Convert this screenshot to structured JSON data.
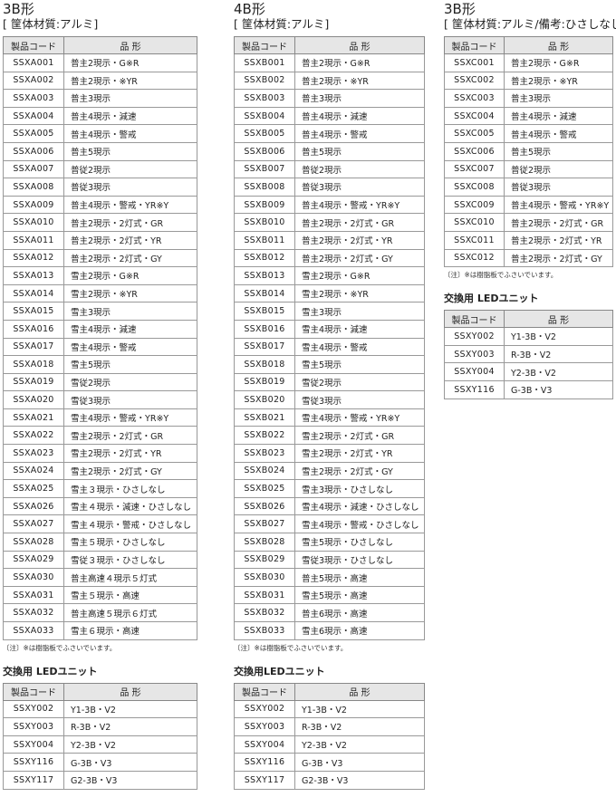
{
  "headers": {
    "code": "製品コード",
    "name": "品 形"
  },
  "sections": [
    {
      "title": "3B形",
      "subtitle": "[ 筐体材質:アルミ]",
      "rows": [
        [
          "SSXA001",
          "普主2現示・G※R"
        ],
        [
          "SSXA002",
          "普主2現示・※YR"
        ],
        [
          "SSXA003",
          "普主3現示"
        ],
        [
          "SSXA004",
          "普主4現示・減速"
        ],
        [
          "SSXA005",
          "普主4現示・警戒"
        ],
        [
          "SSXA006",
          "普主5現示"
        ],
        [
          "SSXA007",
          "普従2現示"
        ],
        [
          "SSXA008",
          "普従3現示"
        ],
        [
          "SSXA009",
          "普主4現示・警戒・YR※Y"
        ],
        [
          "SSXA010",
          "普主2現示・2灯式・GR"
        ],
        [
          "SSXA011",
          "普主2現示・2灯式・YR"
        ],
        [
          "SSXA012",
          "普主2現示・2灯式・GY"
        ],
        [
          "SSXA013",
          "雪主2現示・G※R"
        ],
        [
          "SSXA014",
          "雪主2現示・※YR"
        ],
        [
          "SSXA015",
          "雪主3現示"
        ],
        [
          "SSXA016",
          "雪主4現示・減速"
        ],
        [
          "SSXA017",
          "雪主4現示・警戒"
        ],
        [
          "SSXA018",
          "雪主5現示"
        ],
        [
          "SSXA019",
          "雪従2現示"
        ],
        [
          "SSXA020",
          "雪従3現示"
        ],
        [
          "SSXA021",
          "雪主4現示・警戒・YR※Y"
        ],
        [
          "SSXA022",
          "雪主2現示・2灯式・GR"
        ],
        [
          "SSXA023",
          "雪主2現示・2灯式・YR"
        ],
        [
          "SSXA024",
          "雪主2現示・2灯式・GY"
        ],
        [
          "SSXA025",
          "雪主３現示・ひさしなし"
        ],
        [
          "SSXA026",
          "雪主４現示・減速・ひさしなし"
        ],
        [
          "SSXA027",
          "雪主４現示・警戒・ひさしなし"
        ],
        [
          "SSXA028",
          "雪主５現示・ひさしなし"
        ],
        [
          "SSXA029",
          "雪従３現示・ひさしなし"
        ],
        [
          "SSXA030",
          "普主高速４現示５灯式"
        ],
        [
          "SSXA031",
          "雪主５現示・高速"
        ],
        [
          "SSXA032",
          "普主高速５現示６灯式"
        ],
        [
          "SSXA033",
          "雪主６現示・高速"
        ]
      ],
      "note": "〔注〕※は樹脂板でふさいでいます。",
      "led_title": "交換用 LEDユニット",
      "led_rows": [
        [
          "SSXY002",
          "Y1-3B・V2"
        ],
        [
          "SSXY003",
          "R-3B・V2"
        ],
        [
          "SSXY004",
          "Y2-3B・V2"
        ],
        [
          "SSXY116",
          "G-3B・V3"
        ],
        [
          "SSXY117",
          "G2-3B・V3"
        ]
      ]
    },
    {
      "title": "4B形",
      "subtitle": "[ 筐体材質:アルミ]",
      "rows": [
        [
          "SSXB001",
          "普主2現示・G※R"
        ],
        [
          "SSXB002",
          "普主2現示・※YR"
        ],
        [
          "SSXB003",
          "普主3現示"
        ],
        [
          "SSXB004",
          "普主4現示・減速"
        ],
        [
          "SSXB005",
          "普主4現示・警戒"
        ],
        [
          "SSXB006",
          "普主5現示"
        ],
        [
          "SSXB007",
          "普従2現示"
        ],
        [
          "SSXB008",
          "普従3現示"
        ],
        [
          "SSXB009",
          "普主4現示・警戒・YR※Y"
        ],
        [
          "SSXB010",
          "普主2現示・2灯式・GR"
        ],
        [
          "SSXB011",
          "普主2現示・2灯式・YR"
        ],
        [
          "SSXB012",
          "普主2現示・2灯式・GY"
        ],
        [
          "SSXB013",
          "雪主2現示・G※R"
        ],
        [
          "SSXB014",
          "雪主2現示・※YR"
        ],
        [
          "SSXB015",
          "雪主3現示"
        ],
        [
          "SSXB016",
          "雪主4現示・減速"
        ],
        [
          "SSXB017",
          "雪主4現示・警戒"
        ],
        [
          "SSXB018",
          "雪主5現示"
        ],
        [
          "SSXB019",
          "雪従2現示"
        ],
        [
          "SSXB020",
          "雪従3現示"
        ],
        [
          "SSXB021",
          "雪主4現示・警戒・YR※Y"
        ],
        [
          "SSXB022",
          "雪主2現示・2灯式・GR"
        ],
        [
          "SSXB023",
          "雪主2現示・2灯式・YR"
        ],
        [
          "SSXB024",
          "雪主2現示・2灯式・GY"
        ],
        [
          "SSXB025",
          "雪主3現示・ひさしなし"
        ],
        [
          "SSXB026",
          "雪主4現示・減速・ひさしなし"
        ],
        [
          "SSXB027",
          "雪主4現示・警戒・ひさしなし"
        ],
        [
          "SSXB028",
          "雪主5現示・ひさしなし"
        ],
        [
          "SSXB029",
          "雪従3現示・ひさしなし"
        ],
        [
          "SSXB030",
          "普主5現示・高速"
        ],
        [
          "SSXB031",
          "雪主5現示・高速"
        ],
        [
          "SSXB032",
          "普主6現示・高速"
        ],
        [
          "SSXB033",
          "雪主6現示・高速"
        ]
      ],
      "note": "〔注〕※は樹脂板でふさいでいます。",
      "led_title": "交換用LEDユニット",
      "led_rows": [
        [
          "SSXY002",
          "Y1-3B・V2"
        ],
        [
          "SSXY003",
          "R-3B・V2"
        ],
        [
          "SSXY004",
          "Y2-3B・V2"
        ],
        [
          "SSXY116",
          "G-3B・V3"
        ],
        [
          "SSXY117",
          "G2-3B・V3"
        ]
      ]
    },
    {
      "title": "3B形",
      "subtitle": "[ 筐体材質:アルミ/備考:ひさしなし]",
      "rows": [
        [
          "SSXC001",
          "普主2現示・G※R"
        ],
        [
          "SSXC002",
          "普主2現示・※YR"
        ],
        [
          "SSXC003",
          "普主3現示"
        ],
        [
          "SSXC004",
          "普主4現示・減速"
        ],
        [
          "SSXC005",
          "普主4現示・警戒"
        ],
        [
          "SSXC006",
          "普主5現示"
        ],
        [
          "SSXC007",
          "普従2現示"
        ],
        [
          "SSXC008",
          "普従3現示"
        ],
        [
          "SSXC009",
          "普主4現示・警戒・YR※Y"
        ],
        [
          "SSXC010",
          "普主2現示・2灯式・GR"
        ],
        [
          "SSXC011",
          "普主2現示・2灯式・YR"
        ],
        [
          "SSXC012",
          "普主2現示・2灯式・GY"
        ]
      ],
      "note": "〔注〕※は樹脂板でふさいでいます。",
      "led_title": "交換用 LEDユニット",
      "led_rows": [
        [
          "SSXY002",
          "Y1-3B・V2"
        ],
        [
          "SSXY003",
          "R-3B・V2"
        ],
        [
          "SSXY004",
          "Y2-3B・V2"
        ],
        [
          "SSXY116",
          "G-3B・V3"
        ]
      ]
    }
  ]
}
